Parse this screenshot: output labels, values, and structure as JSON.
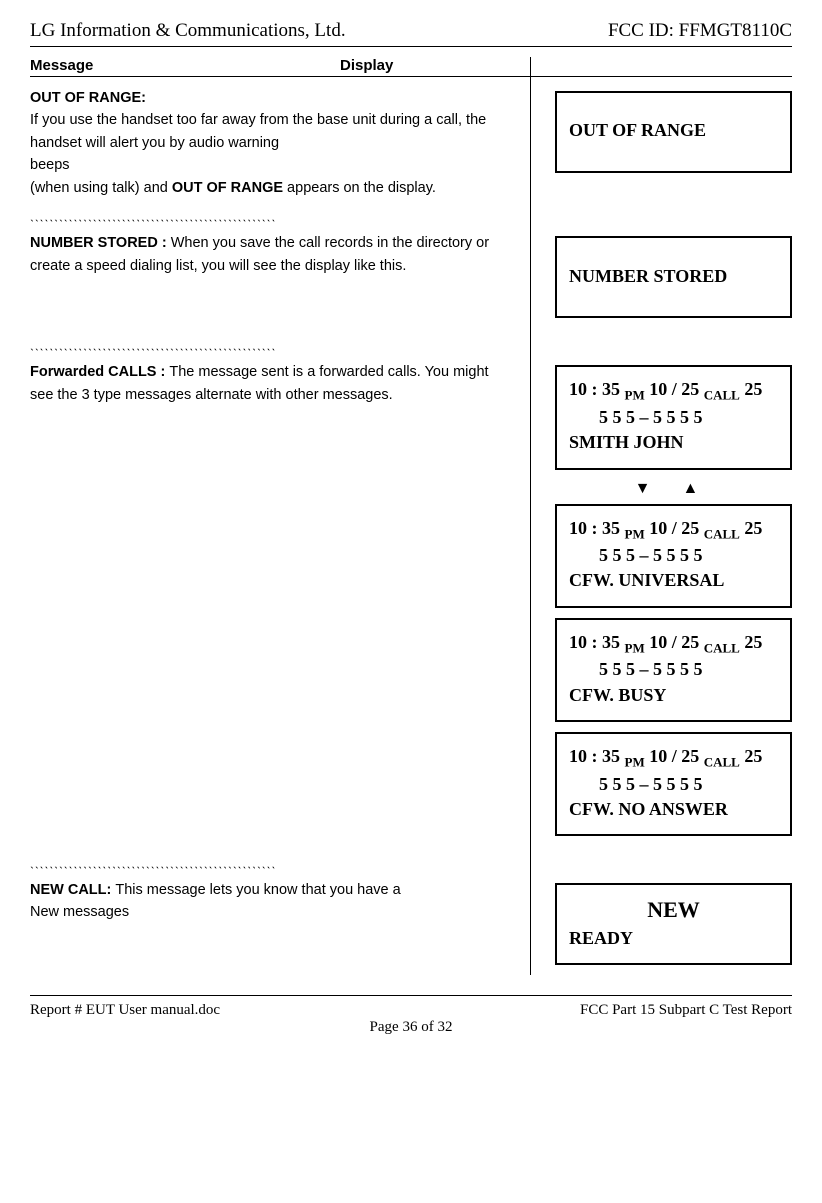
{
  "header": {
    "company": "LG Information & Communications, Ltd.",
    "fcc_id": "FCC ID: FFMGT8110C"
  },
  "columns": {
    "message": "Message",
    "display": "Display"
  },
  "sections": {
    "out_of_range": {
      "title": "OUT OF RANGE:",
      "body_pre": "If you use the handset too far away from the base unit during a call, the handset will alert you by audio warning",
      "body_beeps": " beeps",
      "body_post1": "(when using talk) and ",
      "body_bold": "OUT OF RANGE",
      "body_post2": " appears on the display.",
      "display": "OUT OF RANGE"
    },
    "number_stored": {
      "title": "NUMBER STORED : ",
      "body": "When you save the call records in the directory or create a speed dialing list, you will see the display like this.",
      "display": "NUMBER STORED"
    },
    "forwarded": {
      "title": "Forwarded CALLS : ",
      "body": "The message sent is a forwarded calls. You might see the 3 type messages alternate with other messages.",
      "time_prefix": "10 : 35 ",
      "time_pm": "PM",
      "time_date": " 10 / 25 ",
      "time_call": "CALL",
      "time_count": " 25",
      "phone": "5 5 5 – 5 5 5 5",
      "names": {
        "n1": "SMITH JOHN",
        "n2": "CFW. UNIVERSAL",
        "n3": "CFW. BUSY",
        "n4": "CFW. NO ANSWER"
      }
    },
    "new_call": {
      "title": "NEW CALL: ",
      "body": "This message lets you know that you have a",
      "body2": "New messages",
      "display_top": "NEW",
      "display_bottom": "READY"
    }
  },
  "separator": "ˎˎˎˎˎˎˎˎˎˎˎˎˎˎˎˎˎˎˎˎˎˎˎˎˎˎˎˎˎˎˎˎˎˎˎˎˎˎˎˎˎˎˎˎˎˎˎˎˎˎˎ",
  "footer": {
    "report": "Report # EUT User manual.doc",
    "subpart": "FCC Part 15 Subpart C Test Report",
    "page": "Page 36 of 32"
  }
}
